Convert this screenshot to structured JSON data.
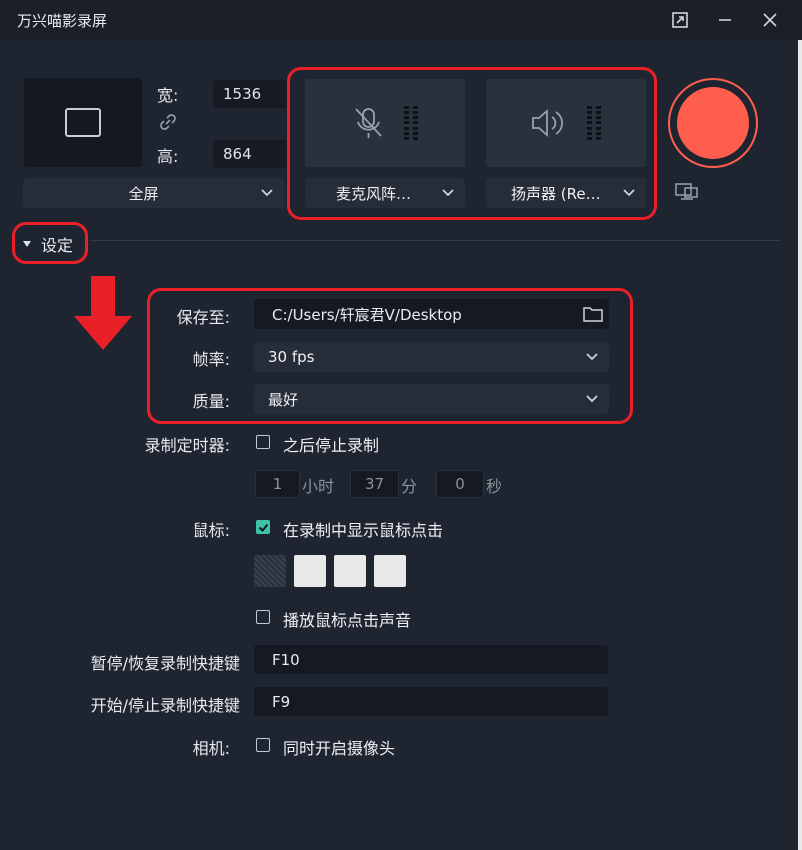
{
  "window": {
    "title": "万兴喵影录屏"
  },
  "area": {
    "width_label": "宽:",
    "width_value": "1536",
    "height_label": "高:",
    "height_value": "864",
    "mode": "全屏"
  },
  "devices": {
    "mic_label": "麦克风阵…",
    "speaker_label": "扬声器 (Re…"
  },
  "settings": {
    "toggle_label": "设定",
    "save_label": "保存至:",
    "save_path": "C:/Users/轩宸君V/Desktop",
    "fps_label": "帧率:",
    "fps_value": "30 fps",
    "quality_label": "质量:",
    "quality_value": "最好",
    "timer_label": "录制定时器:",
    "timer_check": "之后停止录制",
    "timer_hours": "1",
    "timer_hours_unit": "小时",
    "timer_minutes": "37",
    "timer_minutes_unit": "分",
    "timer_seconds": "0",
    "timer_seconds_unit": "秒",
    "mouse_label": "鼠标:",
    "mouse_check": "在录制中显示鼠标点击",
    "mouse_sound_check": "播放鼠标点击声音",
    "pause_hotkey_label": "暂停/恢复录制快捷键",
    "pause_hotkey_value": "F10",
    "start_hotkey_label": "开始/停止录制快捷键",
    "start_hotkey_value": "F9",
    "camera_label": "相机:",
    "camera_check": "同时开启摄像头"
  },
  "colors": {
    "accent_record": "#ff5e4d",
    "highlight_red": "#ea2029",
    "checkbox_checked": "#3fc3a6"
  }
}
